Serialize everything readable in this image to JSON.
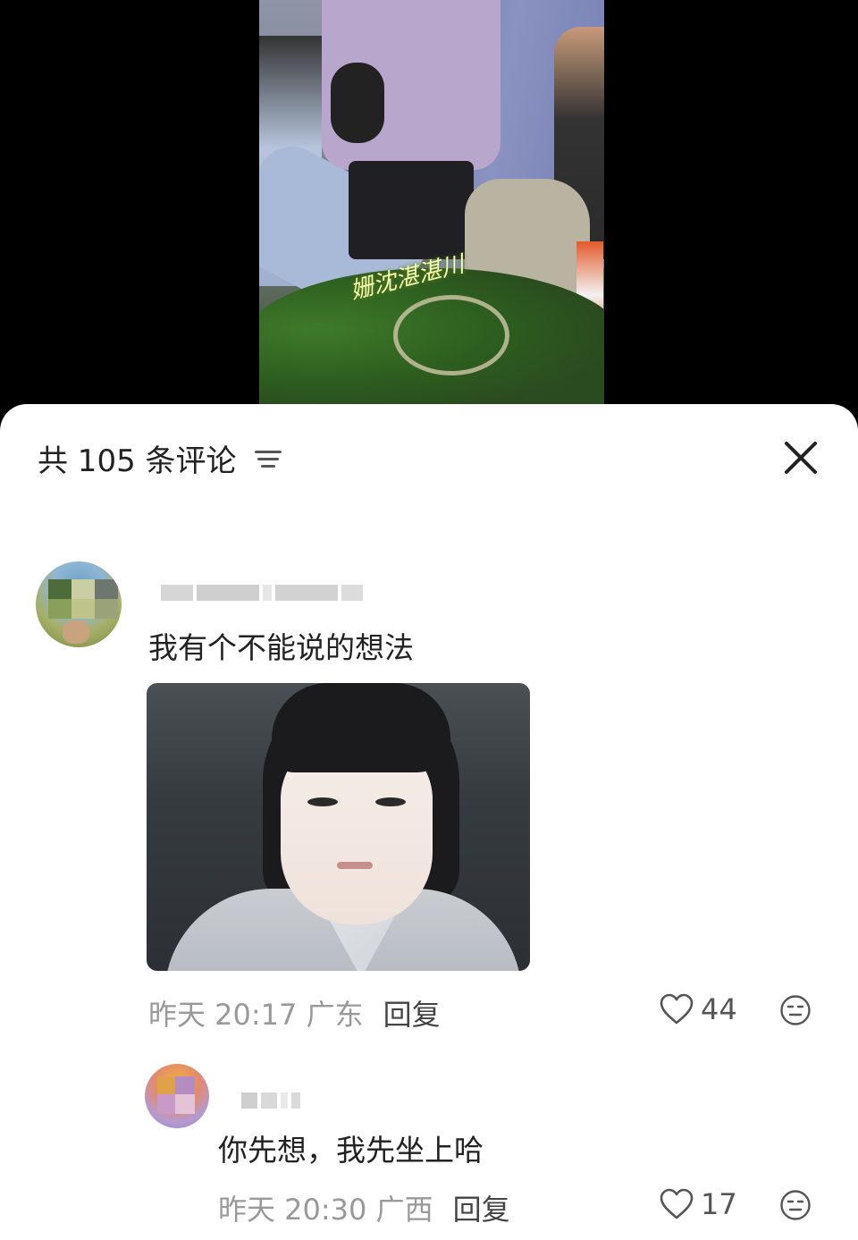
{
  "video": {
    "watermark": "姗沈湛湛川"
  },
  "comments_sheet": {
    "title": "共 105 条评论",
    "comments": [
      {
        "text": "我有个不能说的想法",
        "time": "昨天 20:17",
        "location": "广东",
        "reply_label": "回复",
        "likes": "44",
        "has_image": true
      },
      {
        "text": "你先想，我先坐上哈",
        "time": "昨天 20:30",
        "location": "广西",
        "reply_label": "回复",
        "likes": "17"
      }
    ]
  }
}
